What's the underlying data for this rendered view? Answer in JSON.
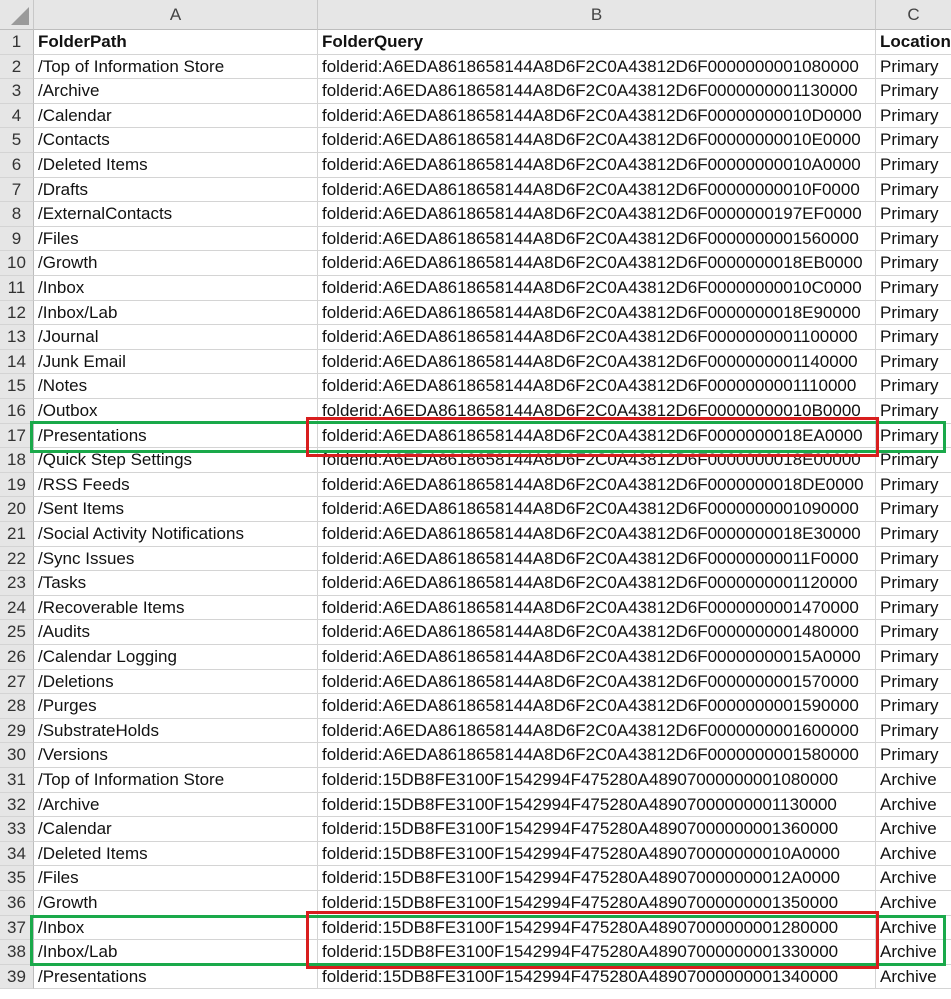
{
  "columns": {
    "a": "A",
    "b": "B",
    "c": "C"
  },
  "rows": [
    {
      "n": "1",
      "path": "FolderPath",
      "query": "FolderQuery",
      "loc": "Location",
      "header": true
    },
    {
      "n": "2",
      "path": "/Top of Information Store",
      "query": "folderid:A6EDA8618658144A8D6F2C0A43812D6F0000000001080000",
      "loc": "Primary"
    },
    {
      "n": "3",
      "path": "/Archive",
      "query": "folderid:A6EDA8618658144A8D6F2C0A43812D6F0000000001130000",
      "loc": "Primary"
    },
    {
      "n": "4",
      "path": "/Calendar",
      "query": "folderid:A6EDA8618658144A8D6F2C0A43812D6F00000000010D0000",
      "loc": "Primary"
    },
    {
      "n": "5",
      "path": "/Contacts",
      "query": "folderid:A6EDA8618658144A8D6F2C0A43812D6F00000000010E0000",
      "loc": "Primary"
    },
    {
      "n": "6",
      "path": "/Deleted Items",
      "query": "folderid:A6EDA8618658144A8D6F2C0A43812D6F00000000010A0000",
      "loc": "Primary"
    },
    {
      "n": "7",
      "path": "/Drafts",
      "query": "folderid:A6EDA8618658144A8D6F2C0A43812D6F00000000010F0000",
      "loc": "Primary"
    },
    {
      "n": "8",
      "path": "/ExternalContacts",
      "query": "folderid:A6EDA8618658144A8D6F2C0A43812D6F0000000197EF0000",
      "loc": "Primary"
    },
    {
      "n": "9",
      "path": "/Files",
      "query": "folderid:A6EDA8618658144A8D6F2C0A43812D6F0000000001560000",
      "loc": "Primary"
    },
    {
      "n": "10",
      "path": "/Growth",
      "query": "folderid:A6EDA8618658144A8D6F2C0A43812D6F0000000018EB0000",
      "loc": "Primary"
    },
    {
      "n": "11",
      "path": "/Inbox",
      "query": "folderid:A6EDA8618658144A8D6F2C0A43812D6F00000000010C0000",
      "loc": "Primary"
    },
    {
      "n": "12",
      "path": "/Inbox/Lab",
      "query": "folderid:A6EDA8618658144A8D6F2C0A43812D6F0000000018E90000",
      "loc": "Primary"
    },
    {
      "n": "13",
      "path": "/Journal",
      "query": "folderid:A6EDA8618658144A8D6F2C0A43812D6F0000000001100000",
      "loc": "Primary"
    },
    {
      "n": "14",
      "path": "/Junk Email",
      "query": "folderid:A6EDA8618658144A8D6F2C0A43812D6F0000000001140000",
      "loc": "Primary"
    },
    {
      "n": "15",
      "path": "/Notes",
      "query": "folderid:A6EDA8618658144A8D6F2C0A43812D6F0000000001110000",
      "loc": "Primary"
    },
    {
      "n": "16",
      "path": "/Outbox",
      "query": "folderid:A6EDA8618658144A8D6F2C0A43812D6F00000000010B0000",
      "loc": "Primary"
    },
    {
      "n": "17",
      "path": "/Presentations",
      "query": "folderid:A6EDA8618658144A8D6F2C0A43812D6F0000000018EA0000",
      "loc": "Primary"
    },
    {
      "n": "18",
      "path": "/Quick Step Settings",
      "query": "folderid:A6EDA8618658144A8D6F2C0A43812D6F0000000018E00000",
      "loc": "Primary"
    },
    {
      "n": "19",
      "path": "/RSS Feeds",
      "query": "folderid:A6EDA8618658144A8D6F2C0A43812D6F0000000018DE0000",
      "loc": "Primary"
    },
    {
      "n": "20",
      "path": "/Sent Items",
      "query": "folderid:A6EDA8618658144A8D6F2C0A43812D6F0000000001090000",
      "loc": "Primary"
    },
    {
      "n": "21",
      "path": "/Social Activity Notifications",
      "query": "folderid:A6EDA8618658144A8D6F2C0A43812D6F0000000018E30000",
      "loc": "Primary"
    },
    {
      "n": "22",
      "path": "/Sync Issues",
      "query": "folderid:A6EDA8618658144A8D6F2C0A43812D6F00000000011F0000",
      "loc": "Primary"
    },
    {
      "n": "23",
      "path": "/Tasks",
      "query": "folderid:A6EDA8618658144A8D6F2C0A43812D6F0000000001120000",
      "loc": "Primary"
    },
    {
      "n": "24",
      "path": "/Recoverable Items",
      "query": "folderid:A6EDA8618658144A8D6F2C0A43812D6F0000000001470000",
      "loc": "Primary"
    },
    {
      "n": "25",
      "path": "/Audits",
      "query": "folderid:A6EDA8618658144A8D6F2C0A43812D6F0000000001480000",
      "loc": "Primary"
    },
    {
      "n": "26",
      "path": "/Calendar Logging",
      "query": "folderid:A6EDA8618658144A8D6F2C0A43812D6F00000000015A0000",
      "loc": "Primary"
    },
    {
      "n": "27",
      "path": "/Deletions",
      "query": "folderid:A6EDA8618658144A8D6F2C0A43812D6F0000000001570000",
      "loc": "Primary"
    },
    {
      "n": "28",
      "path": "/Purges",
      "query": "folderid:A6EDA8618658144A8D6F2C0A43812D6F0000000001590000",
      "loc": "Primary"
    },
    {
      "n": "29",
      "path": "/SubstrateHolds",
      "query": "folderid:A6EDA8618658144A8D6F2C0A43812D6F0000000001600000",
      "loc": "Primary"
    },
    {
      "n": "30",
      "path": "/Versions",
      "query": "folderid:A6EDA8618658144A8D6F2C0A43812D6F0000000001580000",
      "loc": "Primary"
    },
    {
      "n": "31",
      "path": "/Top of Information Store",
      "query": "folderid:15DB8FE3100F1542994F475280A48907000000001080000",
      "loc": "Archive"
    },
    {
      "n": "32",
      "path": "/Archive",
      "query": "folderid:15DB8FE3100F1542994F475280A48907000000001130000",
      "loc": "Archive"
    },
    {
      "n": "33",
      "path": "/Calendar",
      "query": "folderid:15DB8FE3100F1542994F475280A48907000000001360000",
      "loc": "Archive"
    },
    {
      "n": "34",
      "path": "/Deleted Items",
      "query": "folderid:15DB8FE3100F1542994F475280A489070000000010A0000",
      "loc": "Archive"
    },
    {
      "n": "35",
      "path": "/Files",
      "query": "folderid:15DB8FE3100F1542994F475280A489070000000012A0000",
      "loc": "Archive"
    },
    {
      "n": "36",
      "path": "/Growth",
      "query": "folderid:15DB8FE3100F1542994F475280A48907000000001350000",
      "loc": "Archive"
    },
    {
      "n": "37",
      "path": "/Inbox",
      "query": "folderid:15DB8FE3100F1542994F475280A48907000000001280000",
      "loc": "Archive"
    },
    {
      "n": "38",
      "path": "/Inbox/Lab",
      "query": "folderid:15DB8FE3100F1542994F475280A48907000000001330000",
      "loc": "Archive"
    },
    {
      "n": "39",
      "path": "/Presentations",
      "query": "folderid:15DB8FE3100F1542994F475280A48907000000001340000",
      "loc": "Archive"
    }
  ]
}
